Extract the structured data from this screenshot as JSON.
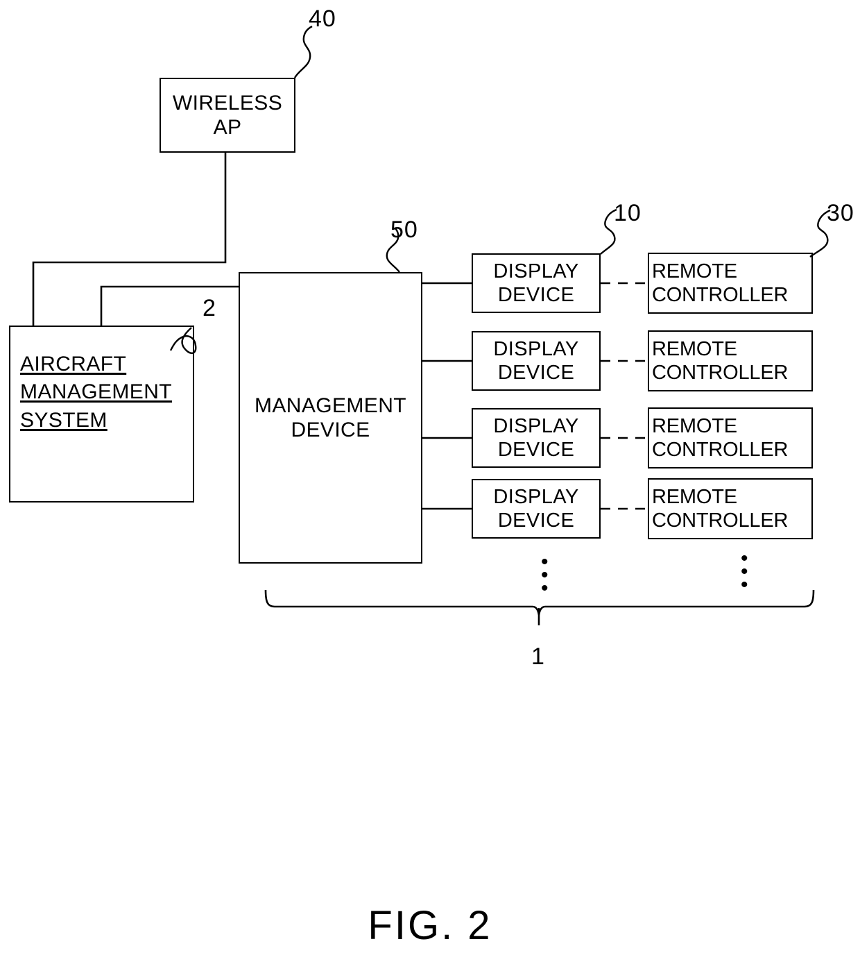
{
  "figure": {
    "caption": "FIG. 2",
    "system_label": "1"
  },
  "nodes": {
    "wireless_ap": {
      "lines": [
        "WIRELESS",
        "AP"
      ],
      "ref": "40"
    },
    "aircraft_management_system": {
      "lines": [
        "AIRCRAFT",
        "MANAGEMENT",
        "SYSTEM"
      ],
      "ref": "2"
    },
    "management_device": {
      "lines": [
        "MANAGEMENT",
        "DEVICE"
      ],
      "ref": "50"
    },
    "display_devices": {
      "ref": "10",
      "items": [
        {
          "lines": [
            "DISPLAY",
            "DEVICE"
          ]
        },
        {
          "lines": [
            "DISPLAY",
            "DEVICE"
          ]
        },
        {
          "lines": [
            "DISPLAY",
            "DEVICE"
          ]
        },
        {
          "lines": [
            "DISPLAY",
            "DEVICE"
          ]
        }
      ]
    },
    "remote_controllers": {
      "ref": "30",
      "items": [
        {
          "lines": [
            "REMOTE",
            "CONTROLLER"
          ]
        },
        {
          "lines": [
            "REMOTE",
            "CONTROLLER"
          ]
        },
        {
          "lines": [
            "REMOTE",
            "CONTROLLER"
          ]
        },
        {
          "lines": [
            "REMOTE",
            "CONTROLLER"
          ]
        }
      ]
    }
  },
  "ellipsis": {
    "display_column": "•••",
    "remote_column": "•••"
  },
  "colors": {
    "line": "#000000",
    "background": "#ffffff"
  }
}
